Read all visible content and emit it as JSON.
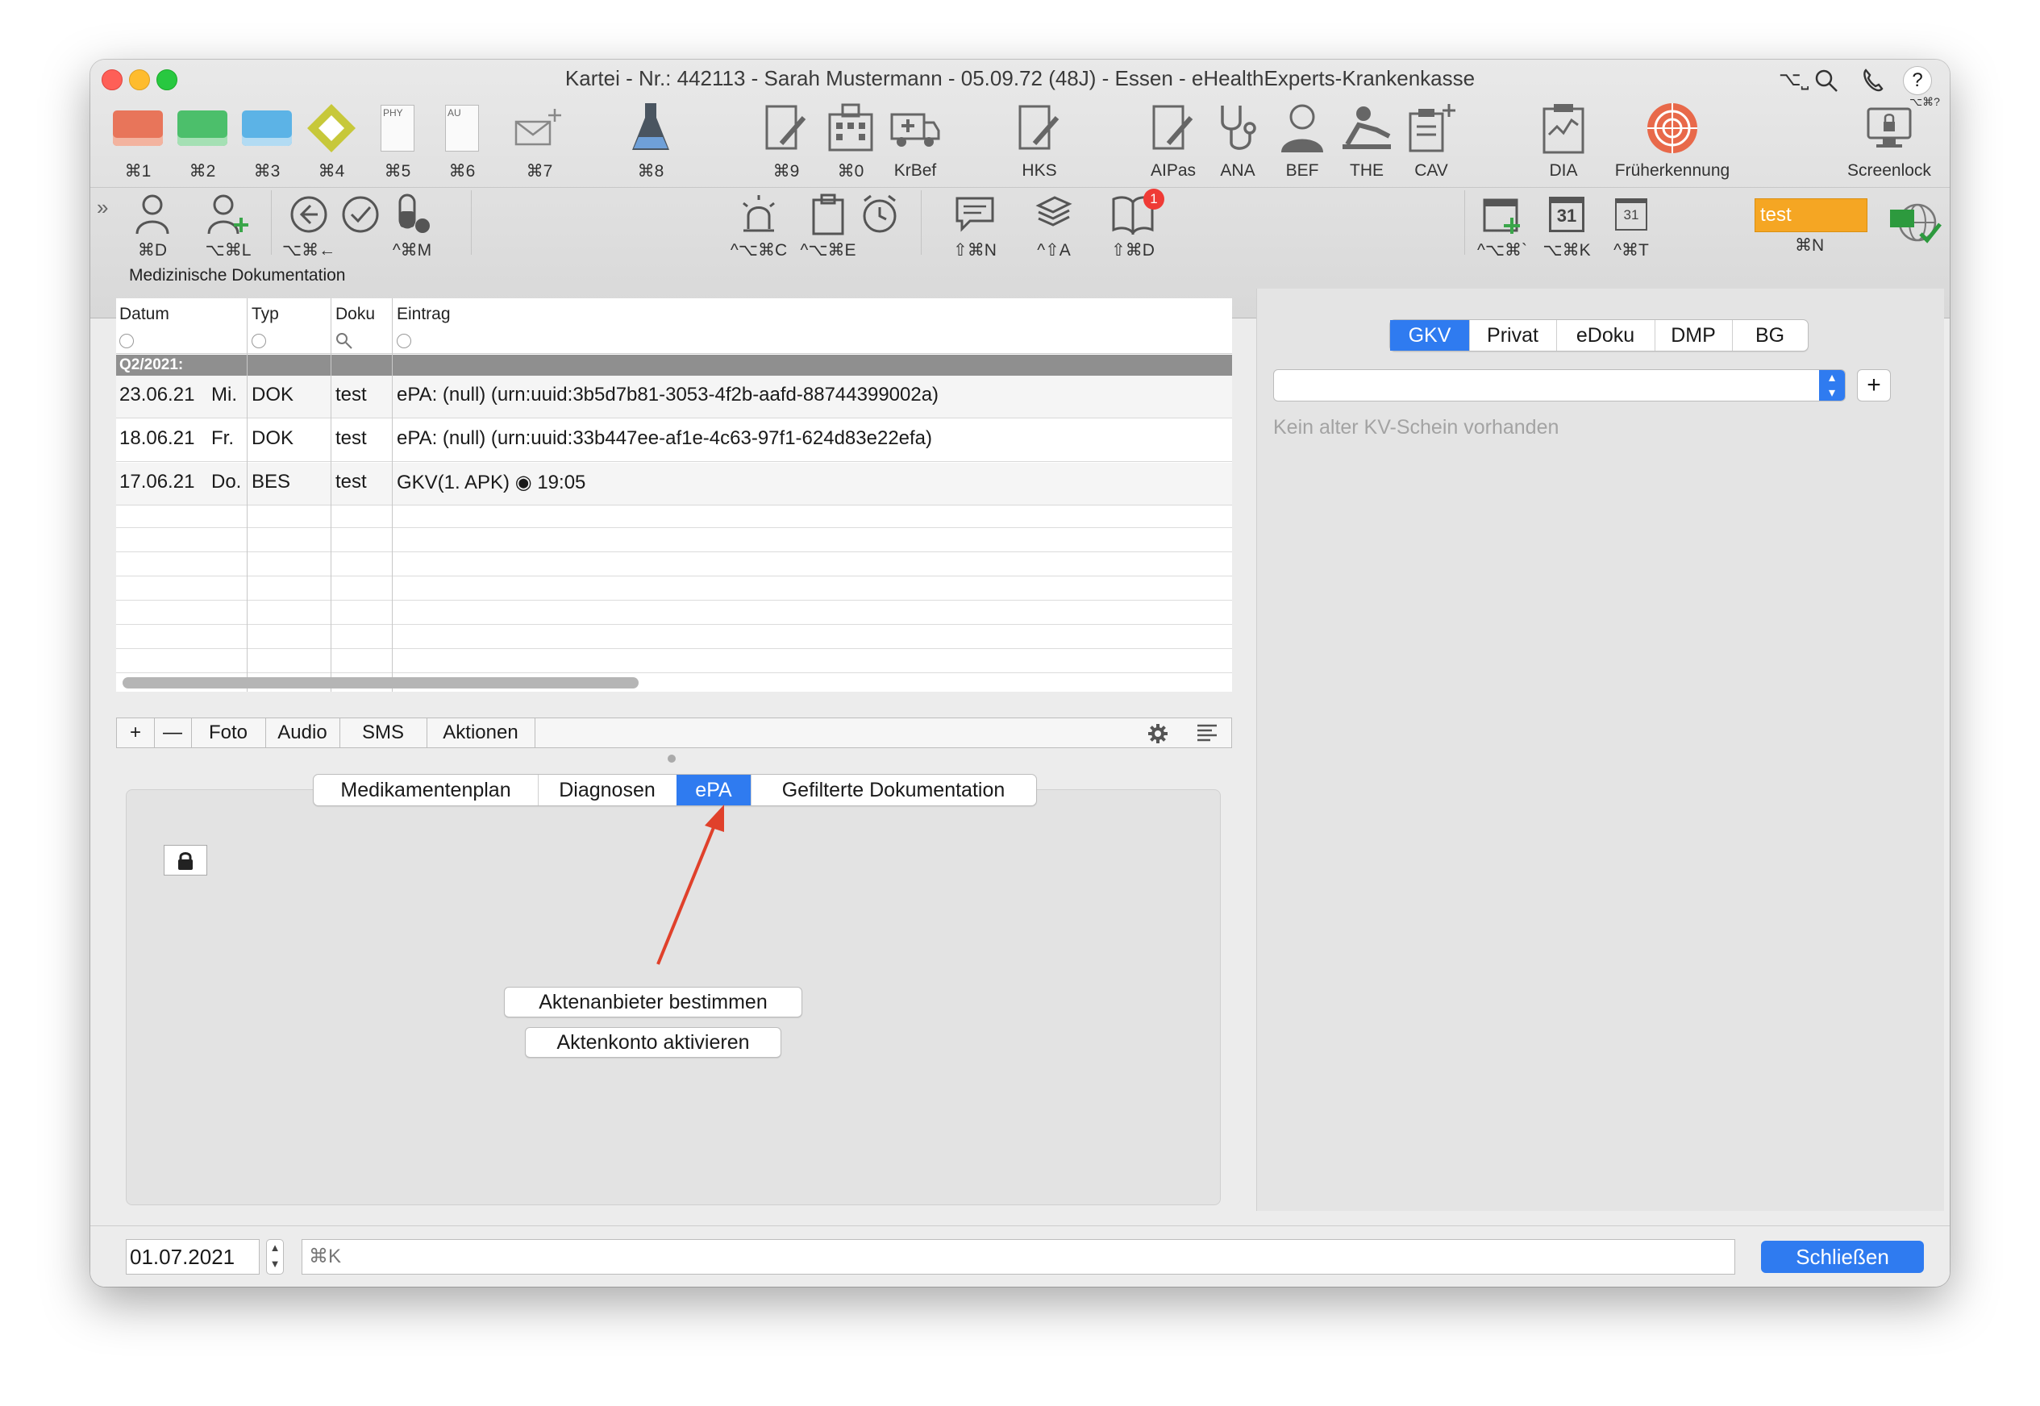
{
  "window": {
    "title": "Kartei - Nr.: 442113 - Sarah Mustermann - 05.09.72 (48J) - Essen - eHealthExperts-Krankenkasse",
    "right_shortcut": "⌥⎵",
    "help_shortcut": "⌥⌘?"
  },
  "toolbar1": [
    {
      "label": "⌘1",
      "icon": "card-red-icon",
      "color": "#e8755a"
    },
    {
      "label": "⌘2",
      "icon": "card-green-icon",
      "color": "#4cbf6b"
    },
    {
      "label": "⌘3",
      "icon": "card-blue-icon",
      "color": "#5cb3e6"
    },
    {
      "label": "⌘4",
      "icon": "card-yellow-icon",
      "color": "#c7c83a"
    },
    {
      "label": "⌘5",
      "icon": "phy-document-icon",
      "doc_text": "PHY"
    },
    {
      "label": "⌘6",
      "icon": "au-document-icon",
      "doc_text": "AU"
    },
    {
      "label": "⌘7",
      "icon": "mail-add-icon"
    },
    {
      "label": "⌘8",
      "icon": "flask-icon"
    },
    {
      "label": "⌘9",
      "icon": "doc-edit-icon"
    },
    {
      "label": "⌘0",
      "icon": "hospital-icon"
    },
    {
      "label": "KrBef",
      "icon": "ambulance-icon"
    },
    {
      "label": "HKS",
      "icon": "doc-edit-icon"
    },
    {
      "label": "AIPas",
      "icon": "doc-edit-icon"
    },
    {
      "label": "ANA",
      "icon": "stethoscope-icon"
    },
    {
      "label": "BEF",
      "icon": "doctor-icon"
    },
    {
      "label": "THE",
      "icon": "therapy-icon"
    },
    {
      "label": "CAV",
      "icon": "clipboard-add-icon"
    },
    {
      "label": "DIA",
      "icon": "clipboard-chart-icon"
    },
    {
      "label": "Früherkennung",
      "icon": "target-icon"
    },
    {
      "label": "Screenlock",
      "icon": "monitor-lock-icon"
    }
  ],
  "toolbar2": {
    "left": [
      {
        "label": "⌘D",
        "icon": "person-icon"
      },
      {
        "label": "⌥⌘L",
        "icon": "person-add-icon"
      },
      {
        "label": "⌥⌘←",
        "icon": "arrow-left-circle-icon"
      },
      {
        "label": "",
        "icon": "checkmark-circle-icon"
      },
      {
        "label": "^⌘M",
        "icon": "pill-icon"
      }
    ],
    "center": [
      {
        "label": "^⌥⌘C",
        "icon": "alarm-light-icon"
      },
      {
        "label": "^⌥⌘E",
        "icon": "clipboard-icon"
      },
      {
        "label": "",
        "icon": "clock-icon"
      },
      {
        "label": "⇧⌘N",
        "icon": "message-icon"
      },
      {
        "label": "^⇧A",
        "icon": "layers-icon"
      },
      {
        "label": "⇧⌘D",
        "icon": "book-icon",
        "badge": "1"
      }
    ],
    "right": [
      {
        "label": "^⌥⌘`",
        "icon": "calendar-add-icon"
      },
      {
        "label": "⌥⌘K",
        "icon": "calendar-31-icon",
        "day": "31"
      },
      {
        "label": "^⌘T",
        "icon": "calendar-31-small-icon",
        "day": "31"
      }
    ],
    "user_field": {
      "value": "test",
      "shortcut": "⌘N",
      "color": "#f5a623"
    }
  },
  "doku": {
    "heading": "Medizinische Dokumentation",
    "columns": [
      "Datum",
      "Typ",
      "Doku",
      "Eintrag"
    ],
    "group": "Q2/2021:",
    "rows": [
      {
        "date": "23.06.21",
        "day": "Mi.",
        "typ": "DOK",
        "doku": "test",
        "eintrag": "ePA: (null) (urn:uuid:3b5d7b81-3053-4f2b-aafd-88744399002a)"
      },
      {
        "date": "18.06.21",
        "day": "Fr.",
        "typ": "DOK",
        "doku": "test",
        "eintrag": "ePA: (null) (urn:uuid:33b447ee-af1e-4c63-97f1-624d83e22efa)"
      },
      {
        "date": "17.06.21",
        "day": "Do.",
        "typ": "BES",
        "doku": "test",
        "eintrag": "GKV(1. APK) ◉ 19:05"
      }
    ],
    "buttons": [
      "+",
      "—",
      "Foto",
      "Audio",
      "SMS",
      "Aktionen"
    ]
  },
  "tabs": {
    "items": [
      "Medikamentenplan",
      "Diagnosen",
      "ePA",
      "Gefilterte Dokumentation"
    ],
    "selected": "ePA"
  },
  "epa": {
    "btn_anbieter": "Aktenanbieter bestimmen",
    "btn_konto": "Aktenkonto aktivieren"
  },
  "insurance": {
    "tabs": [
      "GKV",
      "Privat",
      "eDoku",
      "DMP",
      "BG"
    ],
    "selected": "GKV",
    "note": "Kein alter KV-Schein vorhanden",
    "add": "+"
  },
  "footer": {
    "date": "01.07.2021",
    "search_placeholder": "⌘K",
    "close_label": "Schließen"
  },
  "colors": {
    "accent": "#2f7bf0",
    "annotation_arrow": "#e0412b"
  }
}
